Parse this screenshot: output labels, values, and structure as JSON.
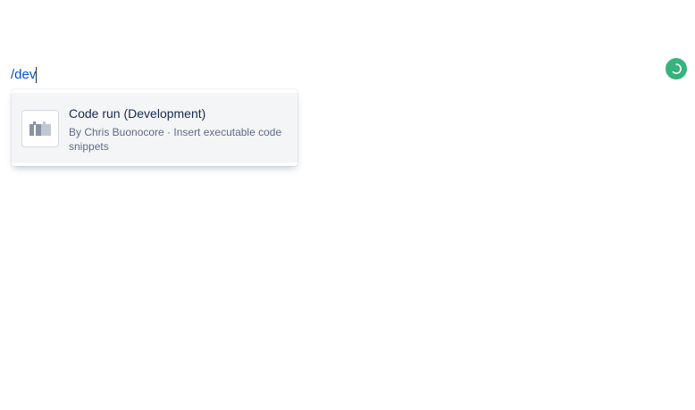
{
  "editor": {
    "query_text": "/dev"
  },
  "status": {
    "icon": "loading-spinner-icon",
    "color": "#36b37e"
  },
  "typeahead": {
    "items": [
      {
        "icon": "macro-placeholder-icon",
        "title": "Code run (Development)",
        "description": "By Chris Buonocore · Insert executable code snippets"
      }
    ]
  },
  "colors": {
    "query": "#0052cc",
    "selected_item_bg": "#f4f5f7",
    "title": "#172b4d",
    "description": "#5e6c84"
  }
}
